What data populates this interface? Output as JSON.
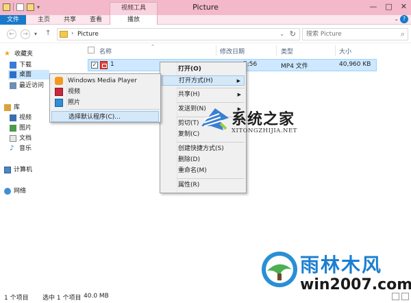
{
  "window": {
    "title": "Picture",
    "context_tab_header": "视频工具",
    "minimize": "—",
    "maximize": "□",
    "close": "✕"
  },
  "ribbon": {
    "tabs": [
      "文件",
      "主页",
      "共享",
      "查看",
      "播放"
    ]
  },
  "address": {
    "path": "Picture",
    "search_placeholder": "搜索 Picture"
  },
  "sidebar": {
    "favorites": "收藏夹",
    "downloads": "下载",
    "desktop": "桌面",
    "recent": "最近访问",
    "libraries": "库",
    "videos": "视频",
    "pictures": "图片",
    "documents": "文档",
    "music": "音乐",
    "computer": "计算机",
    "network": "网络"
  },
  "columns": {
    "name": "名称",
    "modified": "修改日期",
    "type": "类型",
    "size": "大小"
  },
  "file": {
    "name": "1",
    "modified_partial": "7:56",
    "type": "MP4 文件",
    "size": "40,960 KB"
  },
  "context_menu": {
    "open": "打开(O)",
    "open_with": "打开方式(H)",
    "share": "共享(H)",
    "send_to": "发送到(N)",
    "cut": "剪切(T)",
    "copy": "复制(C)",
    "create_shortcut": "创建快捷方式(S)",
    "delete": "删除(D)",
    "rename": "重命名(M)",
    "properties": "属性(R)"
  },
  "open_with_menu": {
    "wmp": "Windows Media Player",
    "video": "视频",
    "photos": "照片",
    "choose_default": "选择默认程序(C)..."
  },
  "status": {
    "count": "1 个项目",
    "selected": "选中 1 个项目",
    "selected_size": "40.0 MB"
  },
  "watermarks": {
    "brand1": "系统之家",
    "url1": "XITONGZHIJIA.NET",
    "brand2": "雨林木风",
    "url2": "win2007.com"
  },
  "colors": {
    "title_bar": "#f3b8c9",
    "file_tab": "#1979ca",
    "selection": "#cde8ff",
    "brand_blue": "#1b7fd2"
  }
}
